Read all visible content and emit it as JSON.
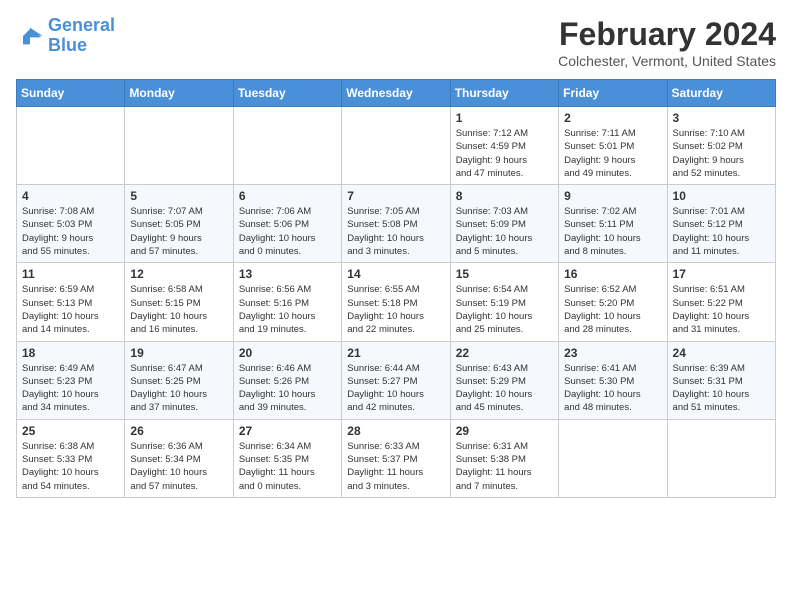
{
  "header": {
    "logo_line1": "General",
    "logo_line2": "Blue",
    "month_title": "February 2024",
    "subtitle": "Colchester, Vermont, United States"
  },
  "days_of_week": [
    "Sunday",
    "Monday",
    "Tuesday",
    "Wednesday",
    "Thursday",
    "Friday",
    "Saturday"
  ],
  "weeks": [
    [
      {
        "day": "",
        "info": ""
      },
      {
        "day": "",
        "info": ""
      },
      {
        "day": "",
        "info": ""
      },
      {
        "day": "",
        "info": ""
      },
      {
        "day": "1",
        "info": "Sunrise: 7:12 AM\nSunset: 4:59 PM\nDaylight: 9 hours\nand 47 minutes."
      },
      {
        "day": "2",
        "info": "Sunrise: 7:11 AM\nSunset: 5:01 PM\nDaylight: 9 hours\nand 49 minutes."
      },
      {
        "day": "3",
        "info": "Sunrise: 7:10 AM\nSunset: 5:02 PM\nDaylight: 9 hours\nand 52 minutes."
      }
    ],
    [
      {
        "day": "4",
        "info": "Sunrise: 7:08 AM\nSunset: 5:03 PM\nDaylight: 9 hours\nand 55 minutes."
      },
      {
        "day": "5",
        "info": "Sunrise: 7:07 AM\nSunset: 5:05 PM\nDaylight: 9 hours\nand 57 minutes."
      },
      {
        "day": "6",
        "info": "Sunrise: 7:06 AM\nSunset: 5:06 PM\nDaylight: 10 hours\nand 0 minutes."
      },
      {
        "day": "7",
        "info": "Sunrise: 7:05 AM\nSunset: 5:08 PM\nDaylight: 10 hours\nand 3 minutes."
      },
      {
        "day": "8",
        "info": "Sunrise: 7:03 AM\nSunset: 5:09 PM\nDaylight: 10 hours\nand 5 minutes."
      },
      {
        "day": "9",
        "info": "Sunrise: 7:02 AM\nSunset: 5:11 PM\nDaylight: 10 hours\nand 8 minutes."
      },
      {
        "day": "10",
        "info": "Sunrise: 7:01 AM\nSunset: 5:12 PM\nDaylight: 10 hours\nand 11 minutes."
      }
    ],
    [
      {
        "day": "11",
        "info": "Sunrise: 6:59 AM\nSunset: 5:13 PM\nDaylight: 10 hours\nand 14 minutes."
      },
      {
        "day": "12",
        "info": "Sunrise: 6:58 AM\nSunset: 5:15 PM\nDaylight: 10 hours\nand 16 minutes."
      },
      {
        "day": "13",
        "info": "Sunrise: 6:56 AM\nSunset: 5:16 PM\nDaylight: 10 hours\nand 19 minutes."
      },
      {
        "day": "14",
        "info": "Sunrise: 6:55 AM\nSunset: 5:18 PM\nDaylight: 10 hours\nand 22 minutes."
      },
      {
        "day": "15",
        "info": "Sunrise: 6:54 AM\nSunset: 5:19 PM\nDaylight: 10 hours\nand 25 minutes."
      },
      {
        "day": "16",
        "info": "Sunrise: 6:52 AM\nSunset: 5:20 PM\nDaylight: 10 hours\nand 28 minutes."
      },
      {
        "day": "17",
        "info": "Sunrise: 6:51 AM\nSunset: 5:22 PM\nDaylight: 10 hours\nand 31 minutes."
      }
    ],
    [
      {
        "day": "18",
        "info": "Sunrise: 6:49 AM\nSunset: 5:23 PM\nDaylight: 10 hours\nand 34 minutes."
      },
      {
        "day": "19",
        "info": "Sunrise: 6:47 AM\nSunset: 5:25 PM\nDaylight: 10 hours\nand 37 minutes."
      },
      {
        "day": "20",
        "info": "Sunrise: 6:46 AM\nSunset: 5:26 PM\nDaylight: 10 hours\nand 39 minutes."
      },
      {
        "day": "21",
        "info": "Sunrise: 6:44 AM\nSunset: 5:27 PM\nDaylight: 10 hours\nand 42 minutes."
      },
      {
        "day": "22",
        "info": "Sunrise: 6:43 AM\nSunset: 5:29 PM\nDaylight: 10 hours\nand 45 minutes."
      },
      {
        "day": "23",
        "info": "Sunrise: 6:41 AM\nSunset: 5:30 PM\nDaylight: 10 hours\nand 48 minutes."
      },
      {
        "day": "24",
        "info": "Sunrise: 6:39 AM\nSunset: 5:31 PM\nDaylight: 10 hours\nand 51 minutes."
      }
    ],
    [
      {
        "day": "25",
        "info": "Sunrise: 6:38 AM\nSunset: 5:33 PM\nDaylight: 10 hours\nand 54 minutes."
      },
      {
        "day": "26",
        "info": "Sunrise: 6:36 AM\nSunset: 5:34 PM\nDaylight: 10 hours\nand 57 minutes."
      },
      {
        "day": "27",
        "info": "Sunrise: 6:34 AM\nSunset: 5:35 PM\nDaylight: 11 hours\nand 0 minutes."
      },
      {
        "day": "28",
        "info": "Sunrise: 6:33 AM\nSunset: 5:37 PM\nDaylight: 11 hours\nand 3 minutes."
      },
      {
        "day": "29",
        "info": "Sunrise: 6:31 AM\nSunset: 5:38 PM\nDaylight: 11 hours\nand 7 minutes."
      },
      {
        "day": "",
        "info": ""
      },
      {
        "day": "",
        "info": ""
      }
    ]
  ]
}
